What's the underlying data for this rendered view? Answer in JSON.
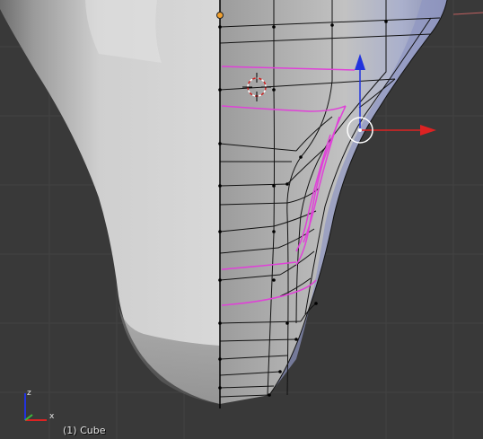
{
  "viewport": {
    "object_label": "(1) Cube",
    "axis_z_label": "z",
    "axis_x_label": "x"
  },
  "colors": {
    "background": "#393939",
    "grid_line": "#414141",
    "solid_mesh_light": "#d4d4d4",
    "solid_mesh_shadow": "#7a7a7a",
    "edit_mesh_tint": "#b7bdd8",
    "wire_black": "#000000",
    "selected_edge_loop": "#e040d8",
    "gizmo_x_red": "#dd2222",
    "gizmo_z_blue": "#2233dd",
    "cursor_red": "#cc2222",
    "origin_orange": "#f0a030",
    "axis_widget_green": "#3cba3c"
  },
  "icons": [
    "3d-cursor-icon",
    "translate-gizmo-icon",
    "object-origin-icon",
    "axis-orientation-icon"
  ]
}
